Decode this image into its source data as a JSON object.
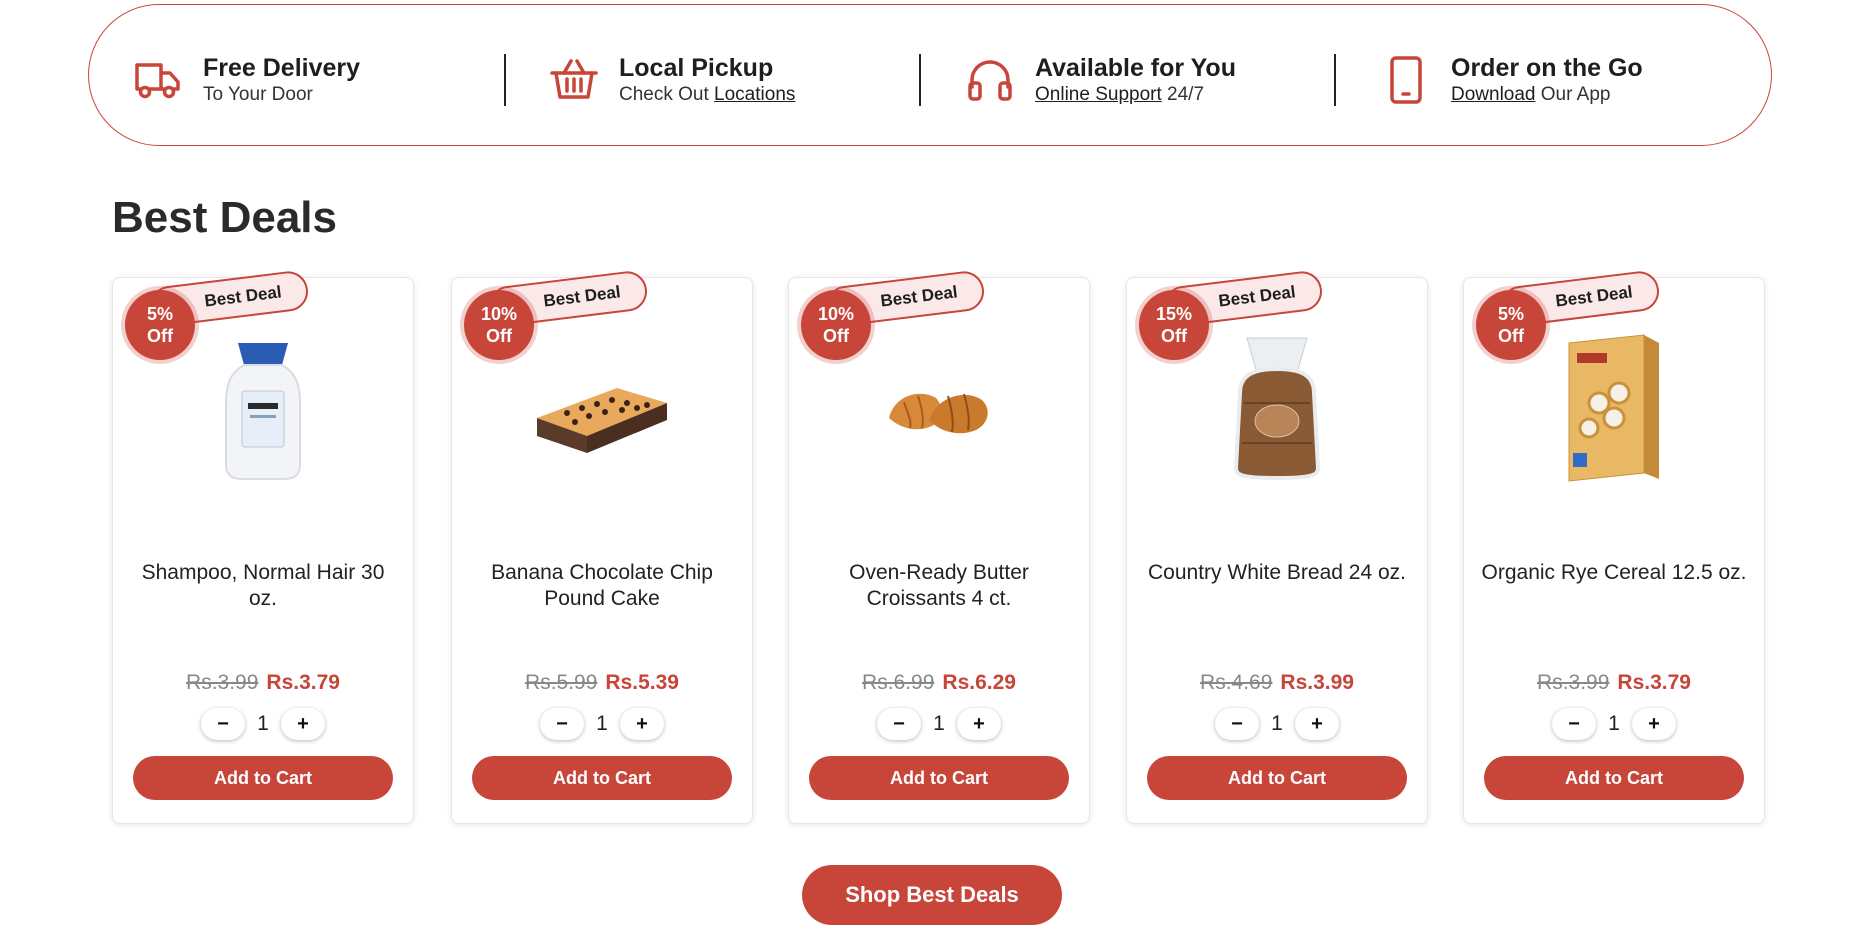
{
  "features": [
    {
      "icon": "truck-icon",
      "title": "Free Delivery",
      "sub_prefix": "To Your Door",
      "sub_link": "",
      "sub_suffix": ""
    },
    {
      "icon": "basket-icon",
      "title": "Local Pickup",
      "sub_prefix": "Check Out ",
      "sub_link": "Locations",
      "sub_suffix": ""
    },
    {
      "icon": "headphones-icon",
      "title": "Available for You",
      "sub_prefix": "",
      "sub_link": "Online Support",
      "sub_suffix": " 24/7"
    },
    {
      "icon": "mobile-phone-icon",
      "title": "Order on the Go",
      "sub_prefix": "",
      "sub_link": "Download",
      "sub_suffix": " Our App"
    }
  ],
  "section_title": "Best Deals",
  "ribbon_label": "Best Deal",
  "add_to_cart_label": "Add to Cart",
  "products": [
    {
      "discount": "5%",
      "off": "Off",
      "name": "Shampoo, Normal Hair 30 oz.",
      "old_price": "Rs.3.99",
      "new_price": "Rs.3.79",
      "qty": "1",
      "image": "shampoo-bottle"
    },
    {
      "discount": "10%",
      "off": "Off",
      "name": "Banana Chocolate Chip Pound Cake",
      "old_price": "Rs.5.99",
      "new_price": "Rs.5.39",
      "qty": "1",
      "image": "pound-cake"
    },
    {
      "discount": "10%",
      "off": "Off",
      "name": "Oven-Ready Butter Croissants 4 ct.",
      "old_price": "Rs.6.99",
      "new_price": "Rs.6.29",
      "qty": "1",
      "image": "croissants"
    },
    {
      "discount": "15%",
      "off": "Off",
      "name": "Country White Bread 24 oz.",
      "old_price": "Rs.4.69",
      "new_price": "Rs.3.99",
      "qty": "1",
      "image": "bread-loaf"
    },
    {
      "discount": "5%",
      "off": "Off",
      "name": "Organic Rye Cereal 12.5 oz.",
      "old_price": "Rs.3.99",
      "new_price": "Rs.3.79",
      "qty": "1",
      "image": "cereal-box"
    }
  ],
  "qty_minus": "−",
  "qty_plus": "+",
  "shop_button": "Shop Best Deals",
  "colors": {
    "accent": "#c8453a",
    "ribbon_bg": "#fbe9ea"
  }
}
